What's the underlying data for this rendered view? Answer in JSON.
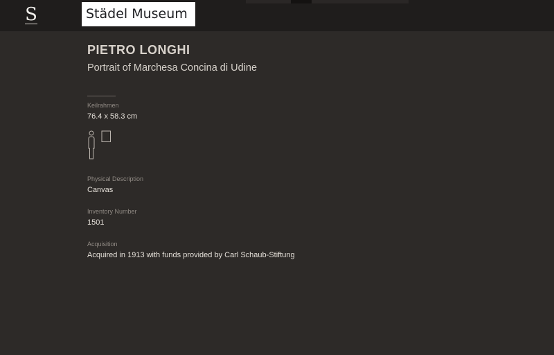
{
  "header": {
    "logo_letter": "S",
    "brand": "Städel Museum"
  },
  "artwork": {
    "artist": "PIETRO LONGHI",
    "title": "Portrait of Marchesa Concina di Udine"
  },
  "details": {
    "dimensions": {
      "label": "Keilrahmen",
      "value": "76.4 x 58.3 cm",
      "scale_icon": "human-scale-icon"
    },
    "physical_description": {
      "label": "Physical Description",
      "value": "Canvas"
    },
    "inventory_number": {
      "label": "Inventory Number",
      "value": "1501"
    },
    "acquisition": {
      "label": "Acquisition",
      "value": "Acquired in 1913 with funds provided by Carl Schaub-Stiftung"
    }
  },
  "colors": {
    "background": "#2d2a28",
    "header": "#1f1d1c",
    "text": "#e4dfd8",
    "muted": "#8f8983"
  }
}
